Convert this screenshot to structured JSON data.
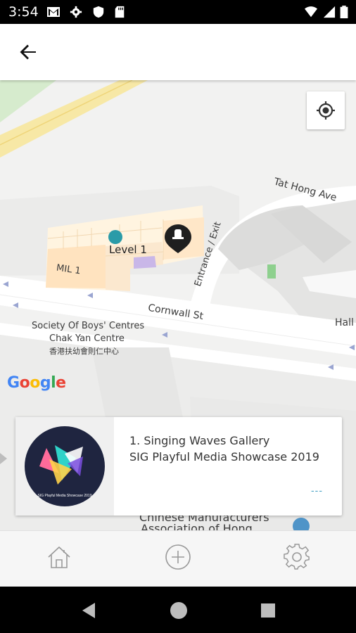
{
  "status_bar": {
    "time": "3:54"
  },
  "app_bar": {
    "back_icon": "arrow-back-icon"
  },
  "map": {
    "streets": {
      "tat_hong_ave": "Tat Hong Ave",
      "cornwall_st": "Cornwall St",
      "entrance_exit": "Entrance / Exit",
      "hall": "Hall"
    },
    "building": {
      "level_label": "Level 1",
      "mil_label": "MIL 1"
    },
    "poi": {
      "society_line1": "Society Of Boys' Centres",
      "society_line2": "Chak Yan Centre",
      "society_line3": "香港扶幼會則仁中心",
      "chinese_mfr_line1": "Chinese Manufacturers",
      "chinese_mfr_line2": "Association of Hong"
    },
    "google_logo": "Google",
    "locate_icon": "my-location-icon"
  },
  "card": {
    "title": "1. Singing Waves Gallery",
    "subtitle": "SIG Playful Media Showcase 2019",
    "more": "---",
    "thumb_caption": "SIG Playful Media Showcase 2019"
  },
  "bottom_nav": {
    "home_icon": "home-icon",
    "add_icon": "add-circle-icon",
    "settings_icon": "gear-icon"
  },
  "colors": {
    "accent": "#2a9ba8",
    "map_bg": "#f2f2f1",
    "road_yellow": "#f7e8a6",
    "thumb_circle": "#1f2540"
  }
}
